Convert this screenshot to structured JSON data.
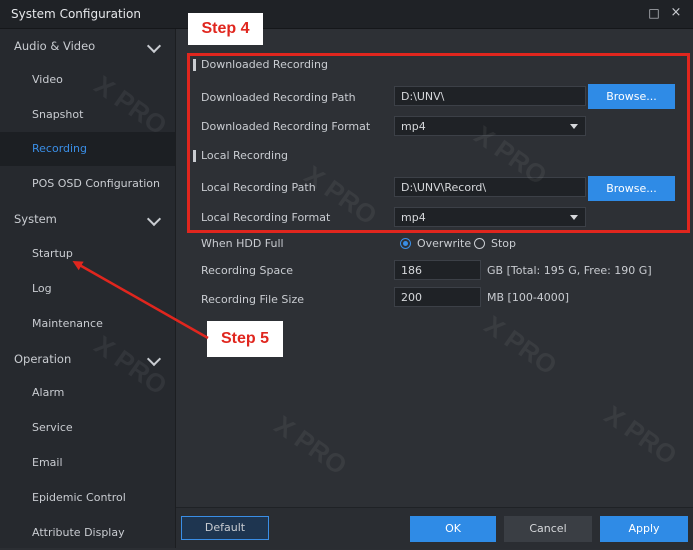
{
  "window": {
    "title": "System Configuration",
    "maximize_icon": "□",
    "close_icon": "×"
  },
  "sidebar": {
    "groups": [
      {
        "label": "Audio & Video",
        "items": [
          "Video",
          "Snapshot",
          "Recording",
          "POS OSD Configuration"
        ]
      },
      {
        "label": "System",
        "items": [
          "Startup",
          "Log",
          "Maintenance"
        ]
      },
      {
        "label": "Operation",
        "items": [
          "Alarm",
          "Service",
          "Email",
          "Epidemic Control",
          "Attribute Display"
        ]
      }
    ],
    "active_item": "Recording"
  },
  "downloaded": {
    "section_title": "Downloaded Recording",
    "path_label": "Downloaded Recording Path",
    "path_value": "D:\\UNV\\",
    "browse_label": "Browse...",
    "format_label": "Downloaded Recording Format",
    "format_value": "mp4"
  },
  "local": {
    "section_title": "Local Recording",
    "path_label": "Local Recording Path",
    "path_value": "D:\\UNV\\Record\\",
    "browse_label": "Browse...",
    "format_label": "Local Recording Format",
    "format_value": "mp4"
  },
  "hdd": {
    "label": "When HDD Full",
    "options": [
      "Overwrite",
      "Stop"
    ],
    "selected": "Overwrite"
  },
  "space": {
    "label": "Recording Space",
    "value": "186",
    "unit": "GB [Total: 195 G, Free: 190 G]"
  },
  "filesize": {
    "label": "Recording File Size",
    "value": "200",
    "unit": "MB [100-4000]"
  },
  "footer": {
    "default_label": "Default",
    "ok_label": "OK",
    "cancel_label": "Cancel",
    "apply_label": "Apply"
  },
  "annotations": {
    "step4": "Step 4",
    "step5": "Step 5",
    "highlight_color": "#e0261e"
  },
  "colors": {
    "accent": "#2f8be6",
    "sidebar_bg": "#26292e",
    "content_bg": "#2d3035"
  }
}
